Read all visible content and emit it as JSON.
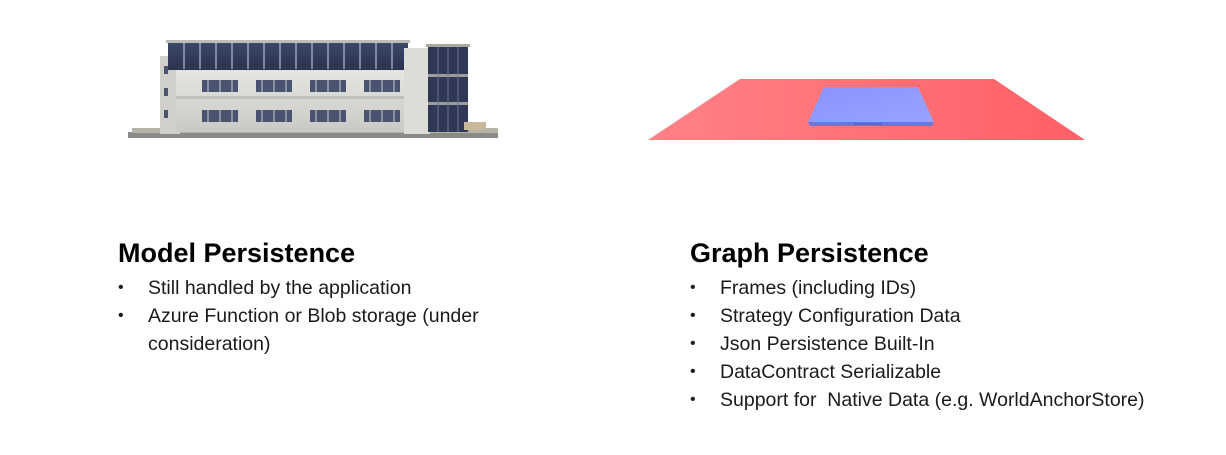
{
  "model_persistence": {
    "title": "Model Persistence",
    "bullets": [
      "Still handled by the application",
      "Azure Function or Blob storage (under consideration)"
    ]
  },
  "graph_persistence": {
    "title": "Graph Persistence",
    "bullets": [
      "Frames (including IDs)",
      "Strategy Configuration Data",
      "Json Persistence Built-In",
      "DataContract Serializable",
      "Support for  Native Data (e.g. WorldAnchorStore)"
    ]
  },
  "bullet_glyph": "•",
  "illustrations": {
    "left": "office-building",
    "right": "red-plane-with-blue-tile",
    "colors": {
      "plane": "#ff6e73",
      "tile": "#8c96ff",
      "building_wall": "#d9d9d6",
      "window": "#3b4560"
    }
  }
}
